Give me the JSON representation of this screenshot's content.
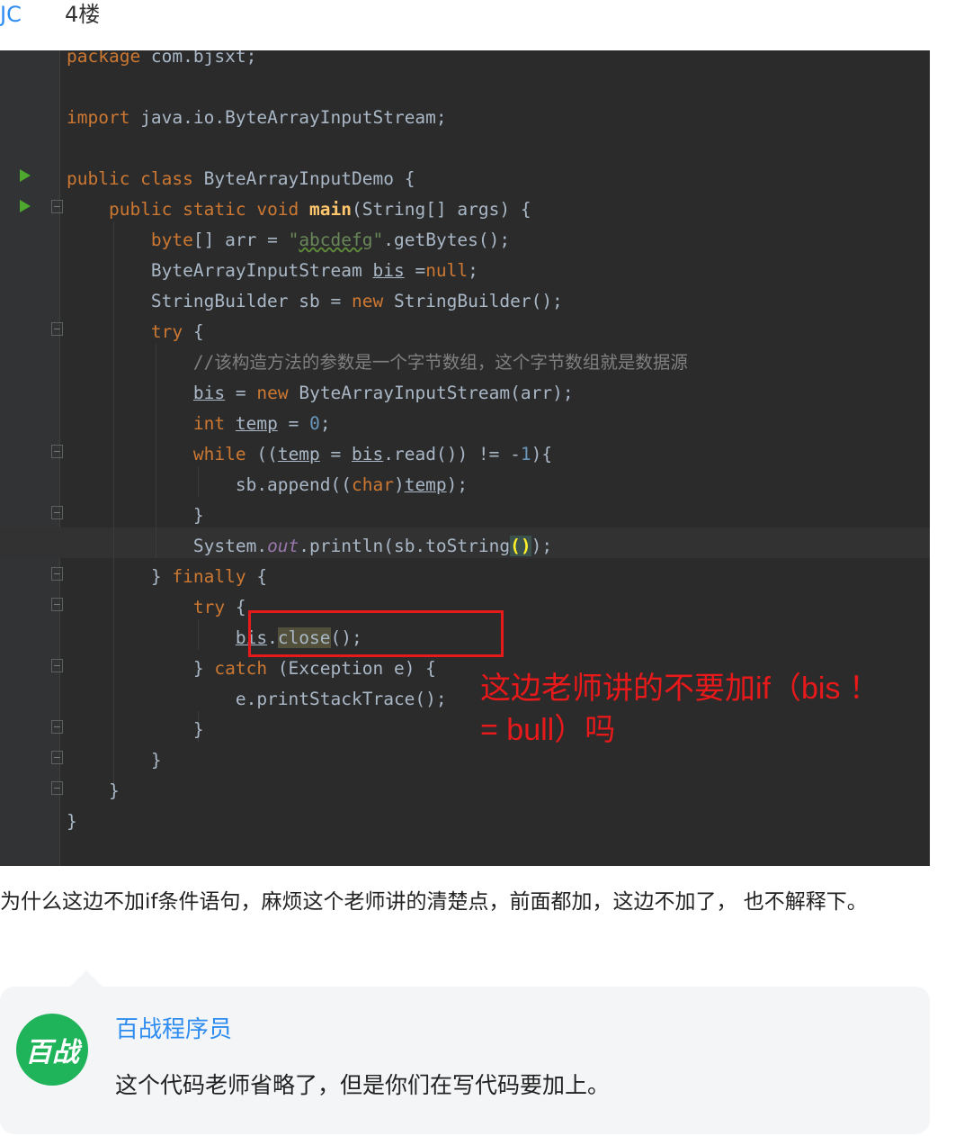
{
  "header": {
    "user": "JC",
    "floor": "4楼"
  },
  "code_lines": [
    "package com.bjsxt;",
    "",
    "import java.io.ByteArrayInputStream;",
    "",
    "public class ByteArrayInputDemo {",
    "    public static void main(String[] args) {",
    "        byte[] arr = \"abcdefg\".getBytes();",
    "        ByteArrayInputStream bis =null;",
    "        StringBuilder sb = new StringBuilder();",
    "        try {",
    "            //该构造方法的参数是一个字节数组，这个字节数组就是数据源",
    "            bis = new ByteArrayInputStream(arr);",
    "            int temp = 0;",
    "            while ((temp = bis.read()) != -1){",
    "                sb.append((char)temp);",
    "            }",
    "            System.out.println(sb.toString());",
    "        } finally {",
    "            try {",
    "                bis.close();",
    "            } catch (Exception e) {",
    "                e.printStackTrace();",
    "            }",
    "        }",
    "    }",
    "}"
  ],
  "annotation": "这边老师讲的不要加if（bis ！= bull）吗",
  "question": "为什么这边不加if条件语句，麻烦这个老师讲的清楚点，前面都加，这边不加了， 也不解释下。",
  "reply": {
    "avatar_text": "百战",
    "name": "百战程序员",
    "text": "这个代码老师省略了，但是你们在写代码要加上。"
  },
  "colors": {
    "link": "#2d8cf0",
    "annotation": "#e8191b",
    "editor_bg": "#2b2b2b",
    "avatar": "#1fb35a"
  }
}
